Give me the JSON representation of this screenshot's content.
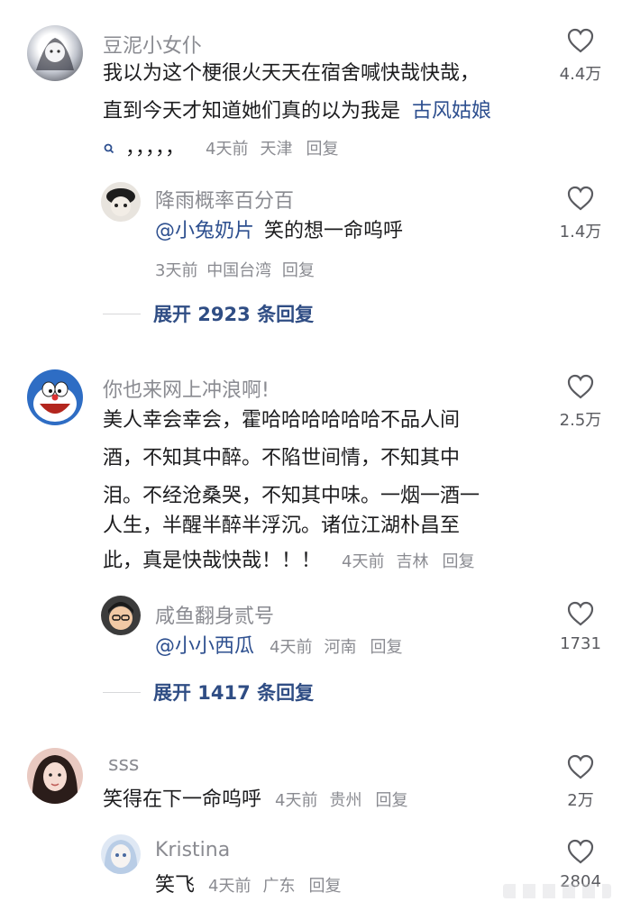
{
  "comments": [
    {
      "username": "豆泥小女仆",
      "text_line1": "我以为这个梗很火天天在宿舍喊快哉快哉，",
      "text_line2_plain": "直到今天才知道她们真的以为我是",
      "text_line2_keyword": "古风姑娘",
      "text_line3_plain": "，，，，，",
      "time": "4天前",
      "location": "天津",
      "reply_label": "回复",
      "likes": "4.4万",
      "reply": {
        "username": "降雨概率百分百",
        "mention": "@小兔奶片",
        "text": "笑的想一命呜呼",
        "time": "3天前",
        "location": "中国台湾",
        "reply_label": "回复",
        "likes": "1.4万"
      },
      "expand_label": "展开 2923 条回复"
    },
    {
      "username": "你也来网上冲浪啊!",
      "lines": [
        "美人幸会幸会，霍哈哈哈哈哈哈不品人间",
        "酒，不知其中醉。不陷世间情，不知其中",
        "泪。不经沧桑哭，不知其中味。一烟一酒一",
        "人生，半醒半醉半浮沉。诸位江湖朴昌至"
      ],
      "last_line": "此，真是快哉快哉！！！",
      "time": "4天前",
      "location": "吉林",
      "reply_label": "回复",
      "likes": "2.5万",
      "reply": {
        "username": "咸鱼翻身贰号",
        "mention": "@小小西瓜",
        "time": "4天前",
        "location": "河南",
        "reply_label": "回复",
        "likes": "1731"
      },
      "expand_label": "展开 1417 条回复"
    },
    {
      "username": "sss",
      "text": "笑得在下一命呜呼",
      "time": "4天前",
      "location": "贵州",
      "reply_label": "回复",
      "likes": "2万",
      "reply": {
        "username": "Kristina",
        "text": "笑飞",
        "time": "4天前",
        "location": "广东",
        "reply_label": "回复",
        "likes": "2804"
      }
    }
  ],
  "icons": {
    "like": "heart-outline-icon",
    "search_keyword": "search-icon"
  },
  "colors": {
    "link_blue": "#2d4f8f",
    "muted_gray": "#8a8b91",
    "text": "#1c1c1e"
  }
}
